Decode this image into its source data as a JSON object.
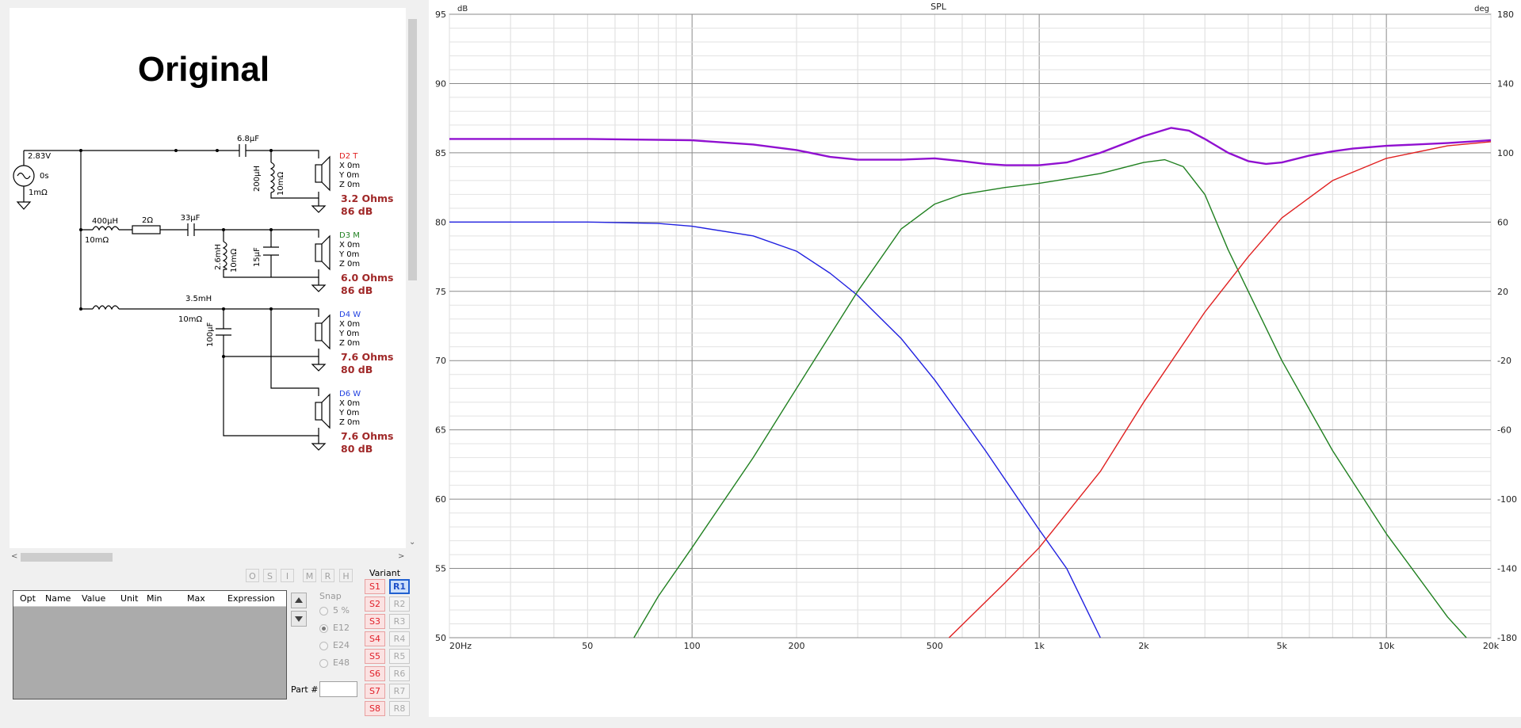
{
  "schematic": {
    "title": "Original",
    "source": {
      "voltage": "2.83V",
      "delay": "0s",
      "resistance": "1mΩ"
    },
    "components": {
      "c1": "6.8µF",
      "l1": "200µH",
      "l1r": "10mΩ",
      "l2": "400µH",
      "l2r": "10mΩ",
      "r1": "2Ω",
      "c2": "33µF",
      "l3": "2.6mH",
      "l3r": "10mΩ",
      "c3": "15µF",
      "l4": "3.5mH",
      "l4r": "10mΩ",
      "c4": "100µF"
    },
    "drivers": [
      {
        "name": "D2 T",
        "color": "#e02020",
        "x": "X 0m",
        "y": "Y 0m",
        "z": "Z 0m",
        "ohms": "3.2 Ohms",
        "db": "86 dB"
      },
      {
        "name": "D3 M",
        "color": "#208020",
        "x": "X 0m",
        "y": "Y 0m",
        "z": "Z 0m",
        "ohms": "6.0 Ohms",
        "db": "86 dB"
      },
      {
        "name": "D4 W",
        "color": "#2040e0",
        "x": "X 0m",
        "y": "Y 0m",
        "z": "Z 0m",
        "ohms": "7.6 Ohms",
        "db": "80 dB"
      },
      {
        "name": "D6 W",
        "color": "#2040e0",
        "x": "X 0m",
        "y": "Y 0m",
        "z": "Z 0m",
        "ohms": "7.6 Ohms",
        "db": "80 dB"
      }
    ]
  },
  "toolbar_buttons": [
    "O",
    "S",
    "I",
    "M",
    "R",
    "H"
  ],
  "table": {
    "columns": [
      "Opt",
      "Name",
      "Value",
      "Unit",
      "Min",
      "Max",
      "Expression"
    ]
  },
  "snap": {
    "label": "Snap",
    "options": [
      "5 %",
      "E12",
      "E24",
      "E48"
    ],
    "selected": "E12"
  },
  "part": {
    "label": "Part #",
    "value": ""
  },
  "variant": {
    "label": "Variant",
    "s": [
      "S1",
      "S2",
      "S3",
      "S4",
      "S5",
      "S6",
      "S7",
      "S8"
    ],
    "r": [
      "R1",
      "R2",
      "R3",
      "R4",
      "R5",
      "R6",
      "R7",
      "R8"
    ],
    "selected": "R1"
  },
  "chart_data": {
    "type": "line",
    "title": "SPL",
    "xlabel": "",
    "ylabel_left": "dB",
    "ylabel_right": "deg",
    "xscale": "log",
    "xlim": [
      20,
      20000
    ],
    "ylim": [
      50,
      95
    ],
    "y2lim": [
      -180,
      180
    ],
    "x_ticks": [
      "20Hz",
      "50",
      "100",
      "200",
      "500",
      "1k",
      "2k",
      "5k",
      "10k",
      "20k"
    ],
    "y_ticks": [
      "95",
      "90",
      "85",
      "80",
      "75",
      "70",
      "65",
      "60",
      "55",
      "50"
    ],
    "y2_ticks": [
      "180",
      "140",
      "100",
      "60",
      "20",
      "-20",
      "-60",
      "-100",
      "-140",
      "-180"
    ],
    "grid": true,
    "series": [
      {
        "color": "#9010d0",
        "points": [
          [
            20,
            86.0
          ],
          [
            50,
            86.0
          ],
          [
            100,
            85.9
          ],
          [
            150,
            85.6
          ],
          [
            200,
            85.2
          ],
          [
            250,
            84.7
          ],
          [
            300,
            84.5
          ],
          [
            400,
            84.5
          ],
          [
            500,
            84.6
          ],
          [
            600,
            84.4
          ],
          [
            700,
            84.2
          ],
          [
            800,
            84.1
          ],
          [
            1000,
            84.1
          ],
          [
            1200,
            84.3
          ],
          [
            1500,
            85.0
          ],
          [
            2000,
            86.2
          ],
          [
            2400,
            86.8
          ],
          [
            2700,
            86.6
          ],
          [
            3000,
            86.0
          ],
          [
            3500,
            85.0
          ],
          [
            4000,
            84.4
          ],
          [
            4500,
            84.2
          ],
          [
            5000,
            84.3
          ],
          [
            6000,
            84.8
          ],
          [
            7000,
            85.1
          ],
          [
            8000,
            85.3
          ],
          [
            10000,
            85.5
          ],
          [
            15000,
            85.7
          ],
          [
            20000,
            85.9
          ]
        ]
      },
      {
        "color": "#2020e0",
        "points": [
          [
            20,
            80.0
          ],
          [
            50,
            80.0
          ],
          [
            80,
            79.9
          ],
          [
            100,
            79.7
          ],
          [
            150,
            79.0
          ],
          [
            200,
            77.9
          ],
          [
            250,
            76.3
          ],
          [
            300,
            74.7
          ],
          [
            400,
            71.6
          ],
          [
            500,
            68.6
          ],
          [
            700,
            63.5
          ],
          [
            1000,
            57.8
          ],
          [
            1200,
            55.0
          ],
          [
            1500,
            50.0
          ]
        ]
      },
      {
        "color": "#208020",
        "points": [
          [
            68,
            50.0
          ],
          [
            80,
            53.0
          ],
          [
            100,
            56.5
          ],
          [
            150,
            63.0
          ],
          [
            200,
            68.0
          ],
          [
            300,
            75.0
          ],
          [
            400,
            79.5
          ],
          [
            500,
            81.3
          ],
          [
            600,
            82.0
          ],
          [
            800,
            82.5
          ],
          [
            1000,
            82.8
          ],
          [
            1500,
            83.5
          ],
          [
            2000,
            84.3
          ],
          [
            2300,
            84.5
          ],
          [
            2600,
            84.0
          ],
          [
            3000,
            82.0
          ],
          [
            3500,
            78.0
          ],
          [
            4000,
            75.0
          ],
          [
            5000,
            70.0
          ],
          [
            7000,
            63.5
          ],
          [
            10000,
            57.5
          ],
          [
            15000,
            51.5
          ],
          [
            17000,
            50.0
          ]
        ]
      },
      {
        "color": "#e02020",
        "points": [
          [
            550,
            50.0
          ],
          [
            800,
            54.0
          ],
          [
            1000,
            56.5
          ],
          [
            1500,
            62.0
          ],
          [
            2000,
            67.0
          ],
          [
            3000,
            73.5
          ],
          [
            4000,
            77.5
          ],
          [
            5000,
            80.3
          ],
          [
            7000,
            83.0
          ],
          [
            10000,
            84.6
          ],
          [
            15000,
            85.5
          ],
          [
            20000,
            85.8
          ]
        ]
      }
    ]
  }
}
